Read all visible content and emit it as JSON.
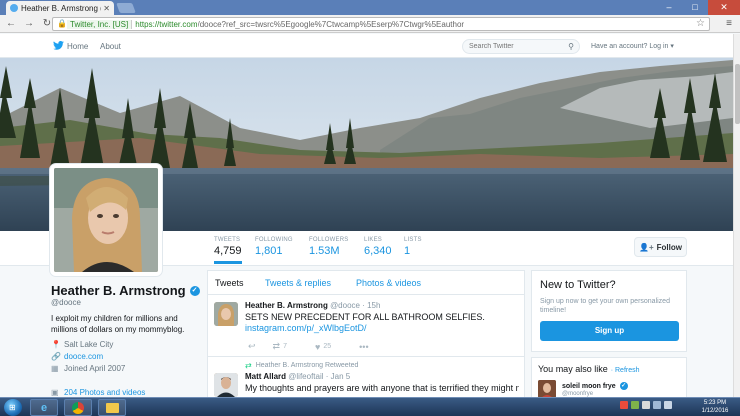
{
  "browser": {
    "tab_title": "Heather B. Armstrong (@d...",
    "ev_badge": "Twitter, Inc. [US]",
    "url_host": "https://twitter.com",
    "url_path": "/dooce?ref_src=twsrc%5Egoogle%7Ctwcamp%5Eserp%7Ctwgr%5Eauthor"
  },
  "twitter_nav": {
    "home": "Home",
    "about": "About",
    "search_placeholder": "Search Twitter",
    "account": "Have an account? Log in ▾"
  },
  "stats": [
    {
      "label": "TWEETS",
      "value": "4,759"
    },
    {
      "label": "FOLLOWING",
      "value": "1,801"
    },
    {
      "label": "FOLLOWERS",
      "value": "1.53M"
    },
    {
      "label": "LIKES",
      "value": "6,340"
    },
    {
      "label": "LISTS",
      "value": "1"
    }
  ],
  "follow_label": "Follow",
  "profile": {
    "name": "Heather B. Armstrong",
    "handle": "@dooce",
    "bio": "I exploit my children for millions and millions of dollars on my mommyblog.",
    "location": "Salt Lake City",
    "website": "dooce.com",
    "joined": "Joined April 2007",
    "photos": "204 Photos and videos"
  },
  "tabs": [
    "Tweets",
    "Tweets & replies",
    "Photos & videos"
  ],
  "tweets": [
    {
      "name": "Heather B. Armstrong",
      "handle": "@dooce · 15h",
      "text": "SETS NEW PRECEDENT FOR ALL BATHROOM SELFIES.",
      "link": "instagram.com/p/_xWlbgEotD/",
      "retweets": "7",
      "likes": "25"
    },
    {
      "retweeted_by": "Heather B. Armstrong Retweeted",
      "name": "Matt Allard",
      "handle": "@lifeoftail · Jan 5",
      "text": "My thoughts and prayers are with anyone that is terrified they might not"
    }
  ],
  "sidebar": {
    "new_title": "New to Twitter?",
    "new_text": "Sign up now to get your own personalized timeline!",
    "signup": "Sign up",
    "like_title": "You may also like",
    "refresh": "· Refresh",
    "suggestion_name": "soleil moon frye",
    "suggestion_handle": "@moonfrye"
  },
  "taskbar": {
    "time": "5:23 PM",
    "date": "1/12/2016"
  },
  "colors": {
    "accent": "#1b95e0",
    "signup": "#1b95e0",
    "verified": "#1b95e0"
  }
}
